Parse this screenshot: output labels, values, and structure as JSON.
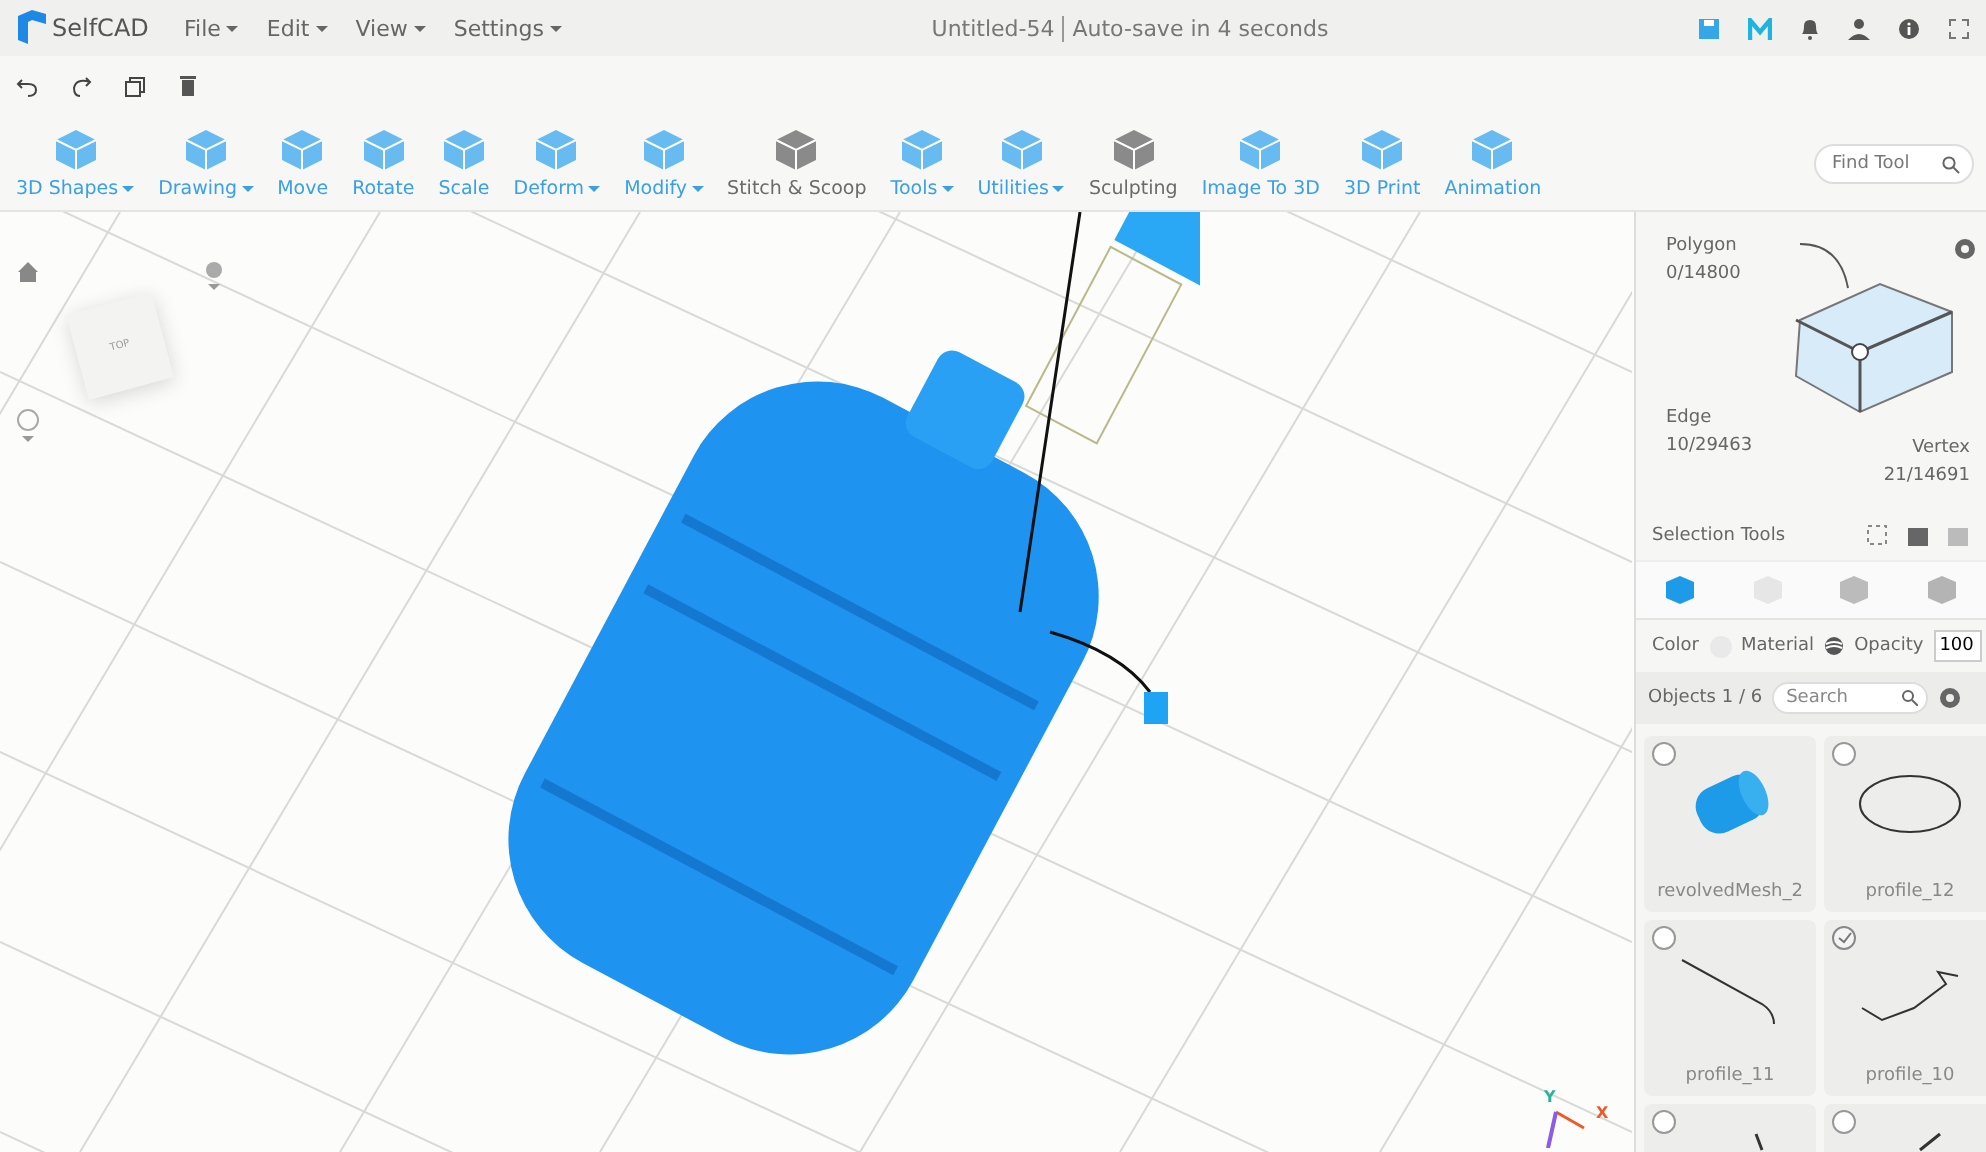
{
  "app": {
    "name": "SelfCAD"
  },
  "menu": [
    {
      "label": "File"
    },
    {
      "label": "Edit"
    },
    {
      "label": "View"
    },
    {
      "label": "Settings"
    }
  ],
  "document": {
    "title": "Untitled-54",
    "status": "Auto-save in 4 seconds"
  },
  "toolbar": [
    {
      "label": "3D Shapes",
      "dropdown": true,
      "color": "#3aa0e6"
    },
    {
      "label": "Drawing",
      "dropdown": true,
      "color": "#3aa0e6"
    },
    {
      "label": "Move",
      "dropdown": false,
      "color": "#3aa0e6"
    },
    {
      "label": "Rotate",
      "dropdown": false,
      "color": "#3aa0e6"
    },
    {
      "label": "Scale",
      "dropdown": false,
      "color": "#3aa0e6"
    },
    {
      "label": "Deform",
      "dropdown": true,
      "color": "#3aa0e6"
    },
    {
      "label": "Modify",
      "dropdown": true,
      "color": "#3aa0e6"
    },
    {
      "label": "Stitch & Scoop",
      "dropdown": false,
      "color": "#6b6b6b"
    },
    {
      "label": "Tools",
      "dropdown": true,
      "color": "#3aa0e6"
    },
    {
      "label": "Utilities",
      "dropdown": true,
      "color": "#3aa0e6"
    },
    {
      "label": "Sculpting",
      "dropdown": false,
      "color": "#6b6b6b"
    },
    {
      "label": "Image To 3D",
      "dropdown": false,
      "color": "#3aa0e6"
    },
    {
      "label": "3D Print",
      "dropdown": false,
      "color": "#3aa0e6"
    },
    {
      "label": "Animation",
      "dropdown": false,
      "color": "#3aa0e6"
    }
  ],
  "find_tool": {
    "placeholder": "Find Tool"
  },
  "viewport": {
    "view_cube": "TOP",
    "axes": [
      {
        "label": "Y",
        "color": "#2bb39a"
      },
      {
        "label": "X",
        "color": "#f05a28"
      }
    ]
  },
  "selection": {
    "polygon": {
      "label": "Polygon",
      "count": "0/14800"
    },
    "edge": {
      "label": "Edge",
      "count": "10/29463"
    },
    "vertex": {
      "label": "Vertex",
      "count": "21/14691"
    },
    "tools_label": "Selection Tools"
  },
  "modes": [
    {
      "selected": true
    },
    {
      "selected": false
    },
    {
      "selected": false
    },
    {
      "selected": false
    }
  ],
  "appearance": {
    "color_label": "Color",
    "material_label": "Material",
    "opacity_label": "Opacity",
    "opacity": "100"
  },
  "objects": {
    "label": "Objects 1 / 6",
    "search_placeholder": "Search",
    "items": [
      {
        "kind": "mesh",
        "name": "revolvedMesh_2",
        "checked": false
      },
      {
        "kind": "ellipse",
        "name": "profile_12",
        "checked": false
      },
      {
        "kind": "line",
        "name": "profile_11",
        "checked": false
      },
      {
        "kind": "zigzag",
        "name": "profile_10",
        "checked": true
      },
      {
        "kind": "hook",
        "checked": false
      },
      {
        "kind": "curve",
        "checked": false
      }
    ]
  }
}
